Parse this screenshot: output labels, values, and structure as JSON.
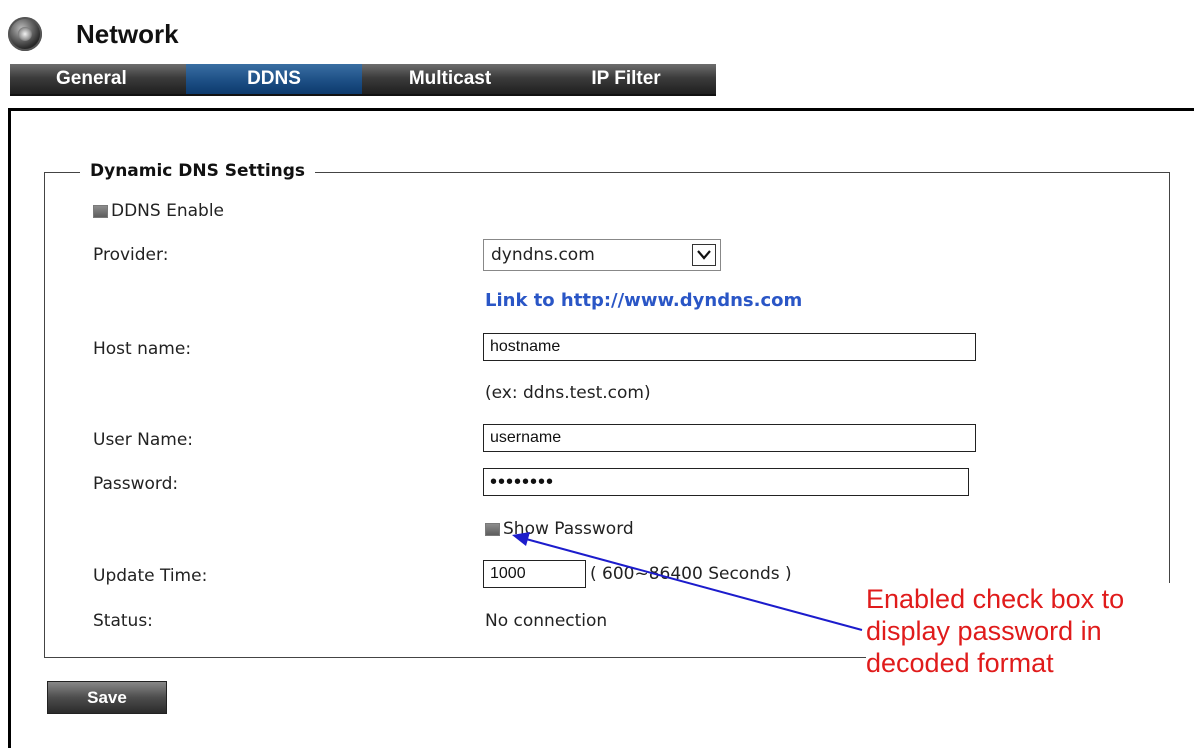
{
  "header": {
    "title": "Network",
    "logo_icon": "camera-lens-icon"
  },
  "tabs": [
    {
      "label": "General",
      "active": false
    },
    {
      "label": "DDNS",
      "active": true
    },
    {
      "label": "Multicast",
      "active": false
    },
    {
      "label": "IP Filter",
      "active": false
    }
  ],
  "section": {
    "legend": "Dynamic DNS Settings",
    "ddns_enable_label": "DDNS Enable",
    "provider_label": "Provider:",
    "provider_value": "dyndns.com",
    "provider_link": "Link to http://www.dyndns.com",
    "host_label": "Host name:",
    "host_value": "hostname",
    "host_hint": "(ex: ddns.test.com)",
    "user_label": "User Name:",
    "user_value": "username",
    "password_label": "Password:",
    "password_value": "••••••••",
    "show_password_label": "Show Password",
    "update_label": "Update Time:",
    "update_value": "1000",
    "update_range": "( 600~86400 Seconds )",
    "status_label": "Status:",
    "status_value": "No connection"
  },
  "save_label": "Save",
  "annotation": {
    "line1": "Enabled check box to",
    "line2": "display password in",
    "line3": "decoded format",
    "color": "#e01b1b",
    "arrow_color": "#1c1ccc"
  }
}
